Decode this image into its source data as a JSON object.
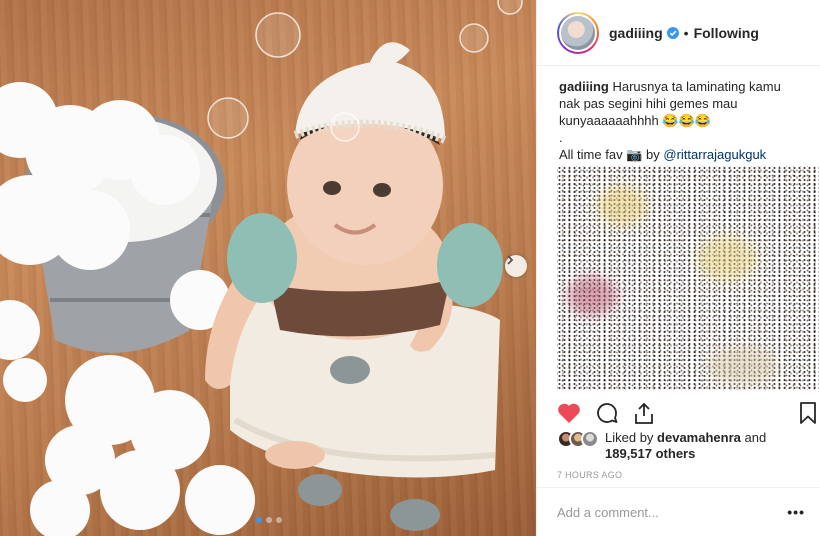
{
  "post": {
    "username": "gadiiing",
    "verified": true,
    "separator": "•",
    "follow_status": "Following",
    "avatar_icon": "profile-avatar",
    "photo_alt": "Baby in knitted outfit and lace bonnet sitting next to a bucket of cotton with soap bubbles"
  },
  "caption": {
    "username": "gadiiing",
    "text": "Harusnya ta laminating kamu nak pas segini hihi gemes mau kunyaaaaaahhhh",
    "emojis": "😂😂😂",
    "dot": ".",
    "line2_prefix": "All time fav",
    "camera_emoji": "📷",
    "line2_by": "by",
    "mention": "@rittarrajagukguk"
  },
  "actions": {
    "like_icon": "heart-icon",
    "comment_icon": "comment-icon",
    "share_icon": "share-icon",
    "save_icon": "bookmark-icon",
    "liked": true
  },
  "likes": {
    "prefix": "Liked by",
    "user": "devamahenra",
    "conjunction": "and",
    "count": "189,517 others"
  },
  "timestamp": "7 HOURS AGO",
  "comment": {
    "placeholder": "Add a comment...",
    "more_label": "•••"
  },
  "carousel": {
    "total": 3,
    "active": 0
  },
  "colors": {
    "like_red": "#ed4956",
    "link_blue": "#003569",
    "verified_blue": "#3897f0",
    "muted": "#999999"
  }
}
